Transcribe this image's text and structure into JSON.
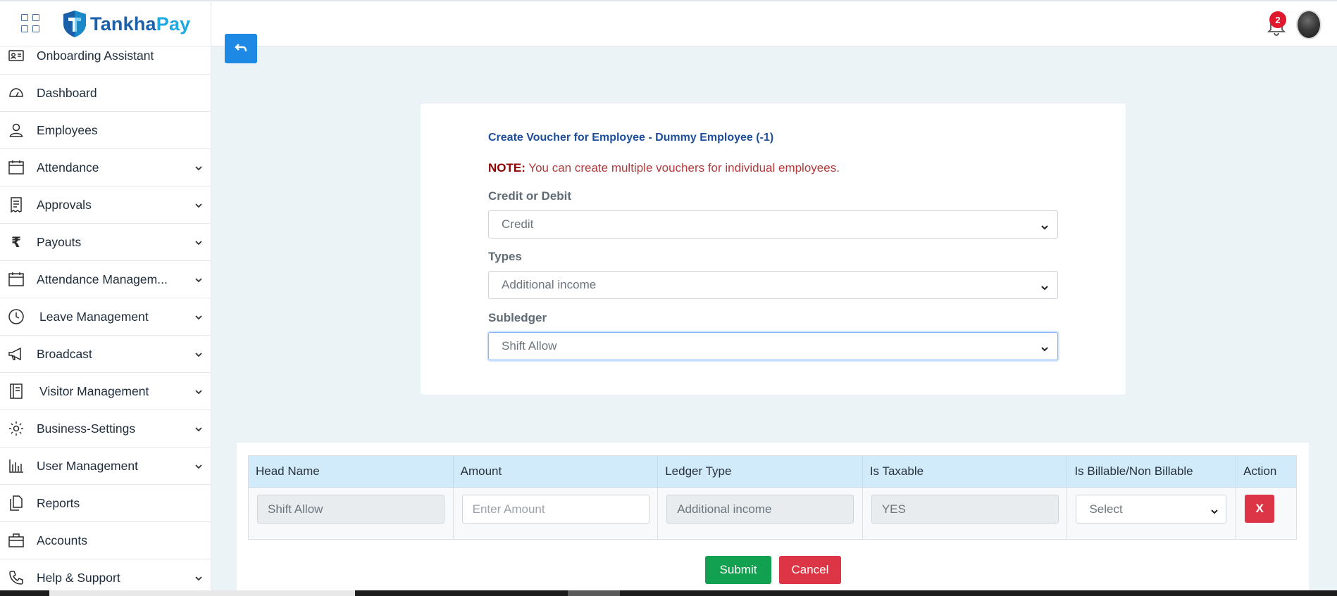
{
  "header": {
    "brand_part1": "Tankha",
    "brand_part2": "Pay",
    "notification_count": "2",
    "brand_colors": {
      "dark": "#1a5fa8",
      "light": "#1ea9e0"
    }
  },
  "sidebar": {
    "items": [
      {
        "label": "Onboarding Assistant",
        "icon": "id-card-icon",
        "expandable": false
      },
      {
        "label": "Dashboard",
        "icon": "speedometer-icon",
        "expandable": false
      },
      {
        "label": "Employees",
        "icon": "user-icon",
        "expandable": false
      },
      {
        "label": "Attendance",
        "icon": "calendar-icon",
        "expandable": true
      },
      {
        "label": "Approvals",
        "icon": "receipt-icon",
        "expandable": true
      },
      {
        "label": "Payouts",
        "icon": "rupee-icon",
        "expandable": true
      },
      {
        "label": "Attendance Managem...",
        "icon": "calendar-icon",
        "expandable": true
      },
      {
        "label": "Leave Management",
        "icon": "clock-icon",
        "expandable": true
      },
      {
        "label": "Broadcast",
        "icon": "megaphone-icon",
        "expandable": true
      },
      {
        "label": "Visitor Management",
        "icon": "notebook-icon",
        "expandable": true
      },
      {
        "label": "Business-Settings",
        "icon": "gear-icon",
        "expandable": true
      },
      {
        "label": "User Management",
        "icon": "users-chart-icon",
        "expandable": true
      },
      {
        "label": "Reports",
        "icon": "documents-icon",
        "expandable": false
      },
      {
        "label": "Accounts",
        "icon": "briefcase-icon",
        "expandable": false
      },
      {
        "label": "Help & Support",
        "icon": "phone-icon",
        "expandable": true
      }
    ]
  },
  "form": {
    "title": "Create Voucher for Employee - Dummy Employee (-1)",
    "note_label": "NOTE:",
    "note_text": " You can create multiple vouchers for individual employees.",
    "credit_debit_label": "Credit or Debit",
    "credit_debit_value": "Credit",
    "types_label": "Types",
    "types_value": "Additional income",
    "subledger_label": "Subledger",
    "subledger_value": "Shift Allow"
  },
  "table": {
    "headers": [
      "Head Name",
      "Amount",
      "Ledger Type",
      "Is Taxable",
      "Is Billable/Non Billable",
      "Action"
    ],
    "row": {
      "head_name": "Shift Allow",
      "amount_placeholder": "Enter Amount",
      "ledger_type": "Additional income",
      "is_taxable": "YES",
      "billable_value": "Select",
      "action_label": "X"
    }
  },
  "actions": {
    "submit_label": "Submit",
    "cancel_label": "Cancel"
  }
}
